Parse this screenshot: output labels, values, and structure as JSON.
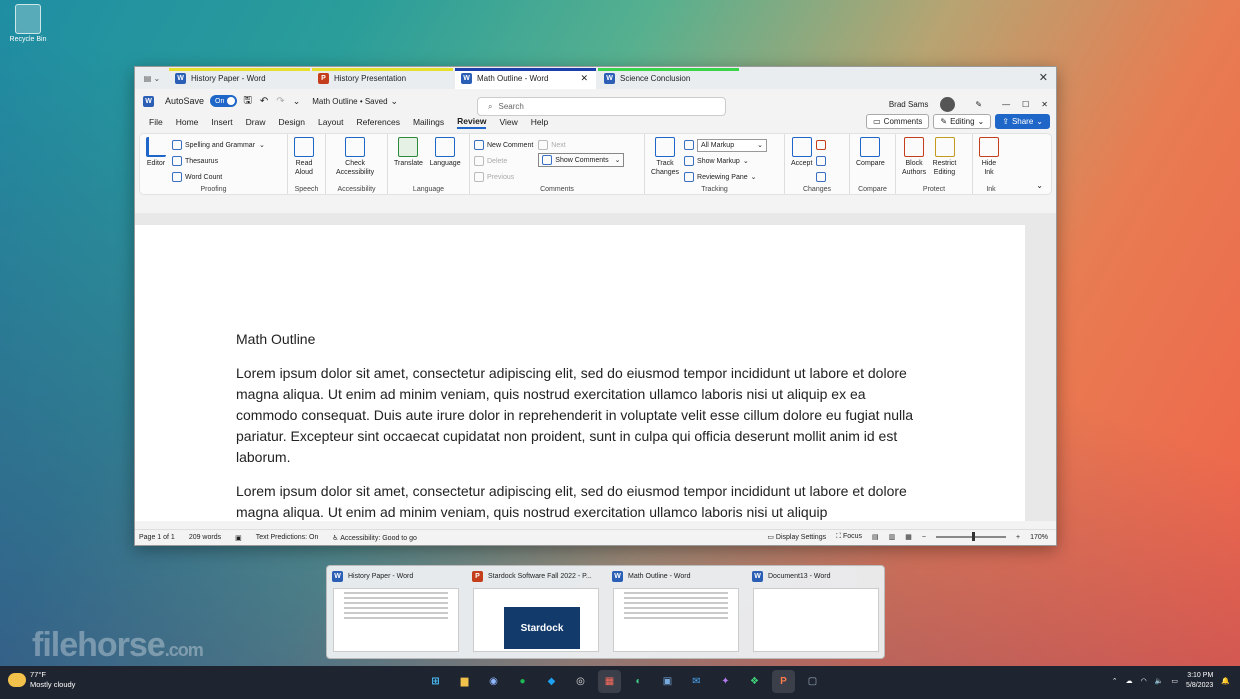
{
  "desktop": {
    "recycle_bin": "Recycle Bin",
    "watermark": "filehorse",
    "watermark_suffix": ".com"
  },
  "group_tabs": [
    {
      "label": "History Paper - Word",
      "app": "word",
      "color": "#e4e02c"
    },
    {
      "label": "History Presentation",
      "app": "powerpoint",
      "color": "#e4e02c"
    },
    {
      "label": "Math Outline - Word",
      "app": "word",
      "color": "#1c3faa",
      "close": "✕"
    },
    {
      "label": "Science Conclusion",
      "app": "word",
      "color": "#39d44a"
    }
  ],
  "window": {
    "close": "✕"
  },
  "title": {
    "autosave": "AutoSave",
    "autosave_state": "On",
    "doc_name": "Math Outline • Saved",
    "search_placeholder": "Search",
    "user": "Brad Sams"
  },
  "menu": [
    "File",
    "Home",
    "Insert",
    "Draw",
    "Design",
    "Layout",
    "References",
    "Mailings",
    "Review",
    "View",
    "Help"
  ],
  "menu_selected": "Review",
  "menu_right": {
    "comments": "Comments",
    "editing": "Editing",
    "share": "Share"
  },
  "ribbon": {
    "proofing": {
      "label": "Proofing",
      "editor": "Editor",
      "spelling": "Spelling and Grammar",
      "thesaurus": "Thesaurus",
      "word_count": "Word Count"
    },
    "speech": {
      "label": "Speech",
      "read_aloud_1": "Read",
      "read_aloud_2": "Aloud"
    },
    "accessibility": {
      "label": "Accessibility",
      "check_1": "Check",
      "check_2": "Accessibility"
    },
    "language": {
      "label": "Language",
      "translate": "Translate",
      "language": "Language"
    },
    "comments": {
      "label": "Comments",
      "new": "New Comment",
      "delete": "Delete",
      "previous": "Previous",
      "next": "Next",
      "show": "Show Comments"
    },
    "tracking": {
      "label": "Tracking",
      "track_1": "Track",
      "track_2": "Changes",
      "markup": "All Markup",
      "show_markup": "Show Markup",
      "reviewing": "Reviewing Pane"
    },
    "changes": {
      "label": "Changes",
      "accept": "Accept"
    },
    "compare": {
      "label": "Compare",
      "compare": "Compare"
    },
    "protect": {
      "label": "Protect",
      "block_1": "Block",
      "block_2": "Authors",
      "restrict_1": "Restrict",
      "restrict_2": "Editing"
    },
    "ink": {
      "label": "Ink",
      "hide_1": "Hide",
      "hide_2": "Ink"
    }
  },
  "document": {
    "title": "Math Outline",
    "paragraphs": [
      "Lorem ipsum dolor sit amet, consectetur adipiscing elit, sed do eiusmod tempor incididunt ut labore et dolore magna aliqua. Ut enim ad minim veniam, quis nostrud exercitation ullamco laboris nisi ut aliquip ex ea commodo consequat. Duis aute irure dolor in reprehenderit in voluptate velit esse cillum dolore eu fugiat nulla pariatur. Excepteur sint occaecat cupidatat non proident, sunt in culpa qui officia deserunt mollit anim id est laborum.",
      "Lorem ipsum dolor sit amet, consectetur adipiscing elit, sed do eiusmod tempor incididunt ut labore et dolore magna aliqua. Ut enim ad minim veniam, quis nostrud exercitation ullamco laboris nisi ut aliquip"
    ]
  },
  "status": {
    "page": "Page 1 of 1",
    "words": "209 words",
    "predictions": "Text Predictions: On",
    "accessibility": "Accessibility: Good to go",
    "display": "Display Settings",
    "focus": "Focus",
    "zoom_minus": "−",
    "zoom_plus": "+",
    "zoom": "170%"
  },
  "previews": [
    {
      "label": "History Paper - Word",
      "app": "word"
    },
    {
      "label": "Stardock Software Fall 2022 - P...",
      "app": "powerpoint",
      "thumb_text": "Stardock"
    },
    {
      "label": "Math Outline - Word",
      "app": "word"
    },
    {
      "label": "Document13 - Word",
      "app": "word"
    }
  ],
  "taskbar": {
    "temp": "77°F",
    "weather": "Mostly cloudy",
    "time": "3:10 PM",
    "date": "5/8/2023",
    "apps": [
      "start",
      "explorer",
      "1password",
      "spotify",
      "twitter",
      "obs",
      "groupy",
      "edge",
      "fences",
      "mail",
      "copilot",
      "start11",
      "powerpoint",
      "remote"
    ]
  }
}
